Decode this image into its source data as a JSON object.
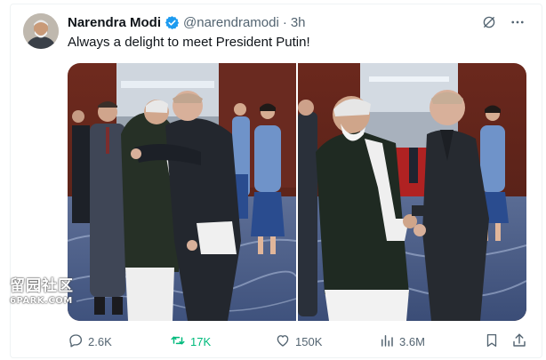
{
  "tweet": {
    "author_name": "Narendra Modi",
    "author_handle": "@narendramodi",
    "separator": "·",
    "time_ago": "3h",
    "text": "Always a delight to meet President Putin!"
  },
  "actions": {
    "reply_count": "2.6K",
    "repost_count": "17K",
    "like_count": "150K",
    "view_count": "3.6M"
  },
  "watermark": {
    "line1": "留园社区",
    "line2": "6PARK.COM"
  },
  "colors": {
    "verified": "#1d9bf0",
    "repost_active": "#00ba7c",
    "secondary_text": "#536471"
  },
  "icons": [
    "verified-badge-icon",
    "grok-icon",
    "more-icon",
    "reply-icon",
    "repost-icon",
    "like-icon",
    "views-icon",
    "bookmark-icon",
    "share-icon"
  ]
}
